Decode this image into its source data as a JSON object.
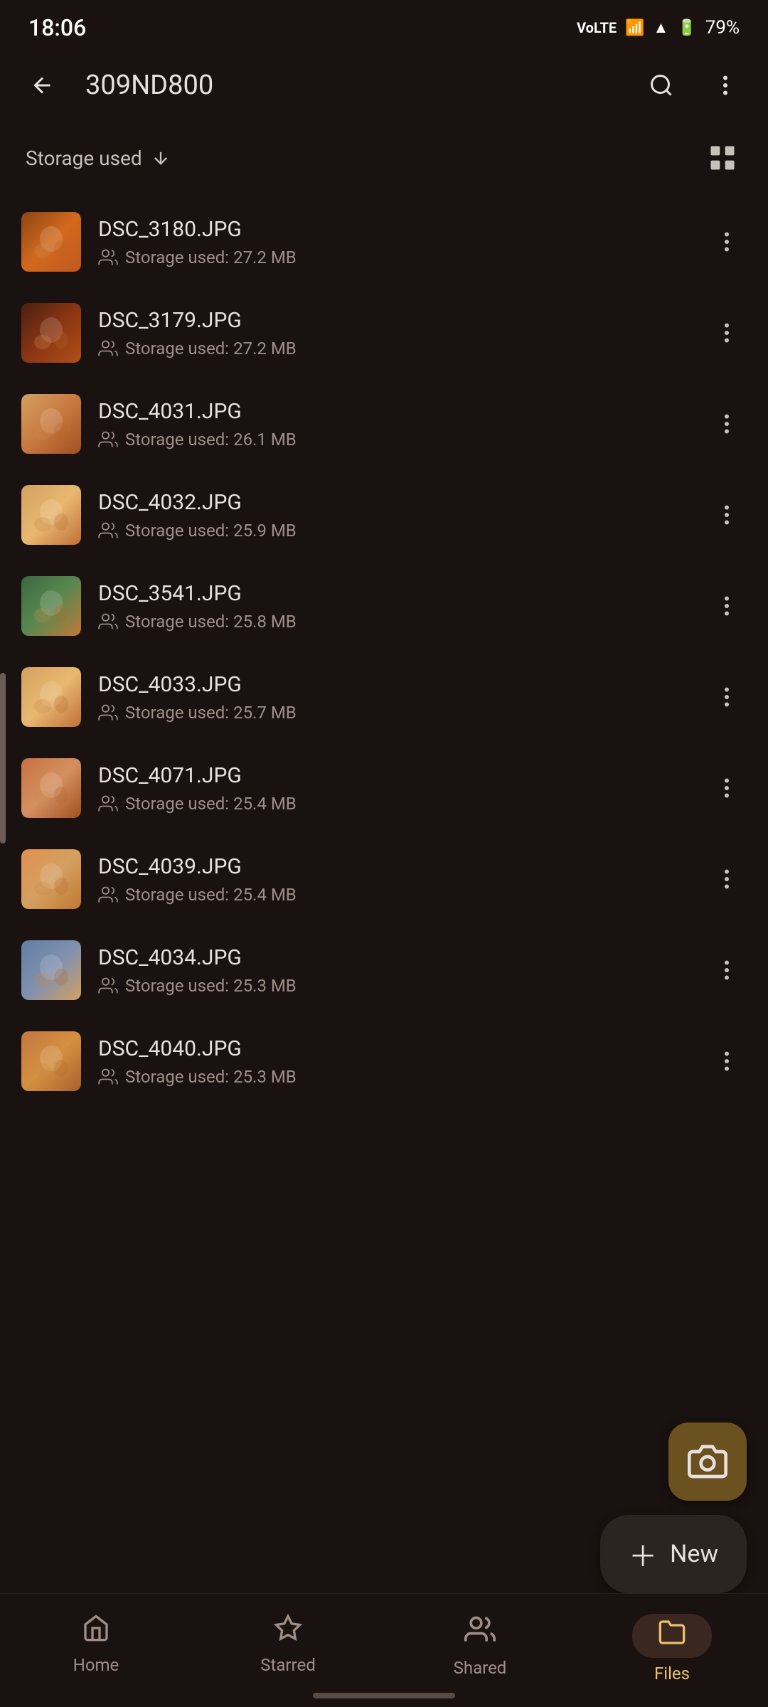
{
  "statusBar": {
    "time": "18:06",
    "battery": "79%"
  },
  "appBar": {
    "title": "309ND800",
    "backLabel": "back",
    "searchLabel": "search",
    "moreLabel": "more options"
  },
  "sortBar": {
    "label": "Storage used",
    "sortIcon": "down-arrow",
    "gridLabel": "grid view"
  },
  "files": [
    {
      "name": "DSC_3180.JPG",
      "size": "Storage used: 27.2 MB",
      "thumbClass": "thumb-1"
    },
    {
      "name": "DSC_3179.JPG",
      "size": "Storage used: 27.2 MB",
      "thumbClass": "thumb-2"
    },
    {
      "name": "DSC_4031.JPG",
      "size": "Storage used: 26.1 MB",
      "thumbClass": "thumb-3"
    },
    {
      "name": "DSC_4032.JPG",
      "size": "Storage used: 25.9 MB",
      "thumbClass": "thumb-4"
    },
    {
      "name": "DSC_3541.JPG",
      "size": "Storage used: 25.8 MB",
      "thumbClass": "thumb-5"
    },
    {
      "name": "DSC_4033.JPG",
      "size": "Storage used: 25.7 MB",
      "thumbClass": "thumb-6"
    },
    {
      "name": "DSC_4071.JPG",
      "size": "Storage used: 25.4 MB",
      "thumbClass": "thumb-7"
    },
    {
      "name": "DSC_4039.JPG",
      "size": "Storage used: 25.4 MB",
      "thumbClass": "thumb-8"
    },
    {
      "name": "DSC_4034.JPG",
      "size": "Storage used: 25.3 MB",
      "thumbClass": "thumb-9"
    },
    {
      "name": "DSC_4040.JPG",
      "size": "Storage used: 25.3 MB",
      "thumbClass": "thumb-10"
    }
  ],
  "fab": {
    "cameraIcon": "📷",
    "newLabel": "New",
    "newIcon": "+"
  },
  "bottomNav": [
    {
      "label": "Home",
      "icon": "🏠",
      "active": false
    },
    {
      "label": "Starred",
      "icon": "☆",
      "active": false
    },
    {
      "label": "Shared",
      "icon": "👥",
      "active": false
    },
    {
      "label": "Files",
      "icon": "📁",
      "active": true
    }
  ]
}
